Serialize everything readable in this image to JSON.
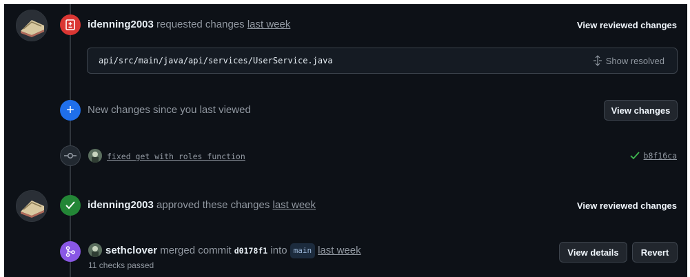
{
  "review1": {
    "author": "idenning2003",
    "action": "requested changes",
    "time": "last week",
    "button": "View reviewed changes",
    "file_path": "api/src/main/java/api/services/UserService.java",
    "show_resolved": "Show resolved"
  },
  "new_changes": {
    "text": "New changes since you last viewed",
    "button": "View changes"
  },
  "commit": {
    "message": "fixed get with roles function",
    "sha": "b8f16ca"
  },
  "review2": {
    "author": "idenning2003",
    "action": "approved these changes",
    "time": "last week",
    "button": "View reviewed changes"
  },
  "merge": {
    "author": "sethclover",
    "action": "merged commit",
    "commit": "d0178f1",
    "into": "into",
    "branch": "main",
    "time": "last week",
    "checks": "11 checks passed",
    "details_button": "View details",
    "revert_button": "Revert"
  },
  "colors": {
    "requested_changes": "#da3633",
    "new_changes": "#1f6feb",
    "approved": "#238636",
    "merged": "#8957e5",
    "success_check": "#3fb950"
  }
}
